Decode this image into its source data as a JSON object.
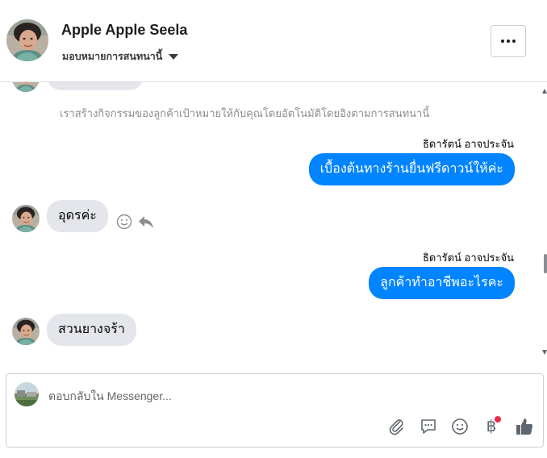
{
  "header": {
    "contact_name": "Apple Apple Seela",
    "assign_label": "มอบหมายการสนทนานี้"
  },
  "thread": {
    "system_note": "เราสร้างกิจกรรมของลูกค้าเป้าหมายให้กับคุณโดยอัตโนมัติโดยอิงตามการสนทนานี้",
    "messages": [
      {
        "direction": "outgoing",
        "sender": "ธิดารัตน์ อาจประจัน",
        "text": "เบื้องต้นทางร้านยื่นฟรีดาวน์ให้ค่ะ"
      },
      {
        "direction": "incoming",
        "text": "อุดรค่ะ"
      },
      {
        "direction": "outgoing",
        "sender": "ธิดารัตน์ อาจประจัน",
        "text": "ลูกค้าทำอาชีพอะไรคะ"
      },
      {
        "direction": "incoming",
        "text": "สวนยางจร้า"
      }
    ]
  },
  "composer": {
    "placeholder": "ตอบกลับใน Messenger...",
    "baht_symbol": "฿",
    "tools": [
      "paperclip-icon",
      "speech-bubble-icon",
      "smiley-icon",
      "baht-icon",
      "thumbs-up-icon"
    ],
    "notification_color": "#f02849"
  },
  "colors": {
    "accent": "#0084ff",
    "incoming_bubble": "#e4e6eb"
  }
}
